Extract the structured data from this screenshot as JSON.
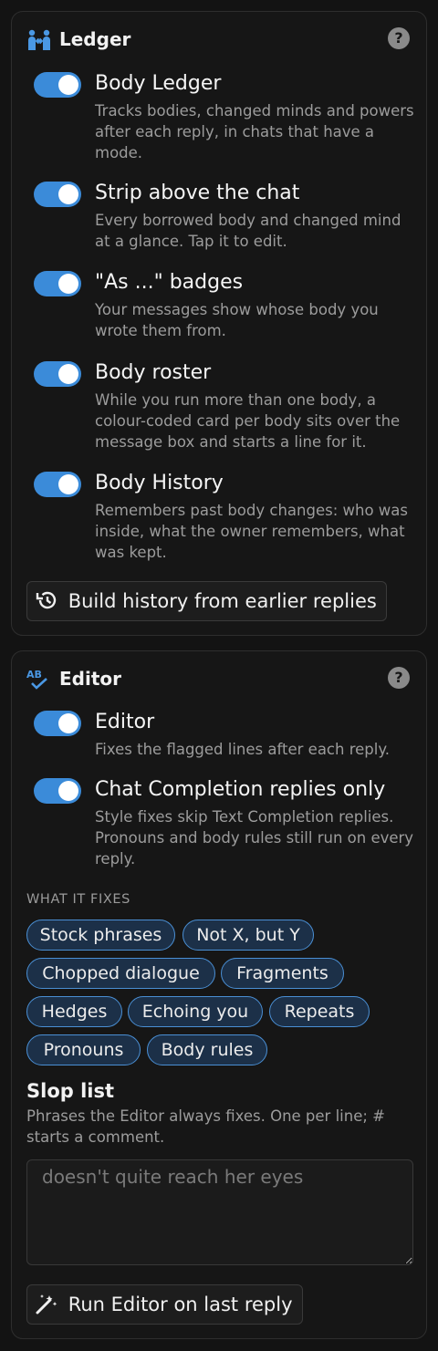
{
  "ledger": {
    "title": "Ledger",
    "help": "?",
    "options": [
      {
        "title": "Body Ledger",
        "desc": "Tracks bodies, changed minds and powers after each reply, in chats that have a mode.",
        "enabled": true
      },
      {
        "title": "Strip above the chat",
        "desc": "Every borrowed body and changed mind at a glance. Tap it to edit.",
        "enabled": true
      },
      {
        "title": "\"As ...\" badges",
        "desc": "Your messages show whose body you wrote them from.",
        "enabled": true
      },
      {
        "title": "Body roster",
        "desc": "While you run more than one body, a colour-coded card per body sits over the message box and starts a line for it.",
        "enabled": true
      },
      {
        "title": "Body History",
        "desc": "Remembers past body changes: who was inside, what the owner remembers, what was kept.",
        "enabled": true
      }
    ],
    "build_button": "Build history from earlier replies"
  },
  "editor": {
    "title": "Editor",
    "icon_text": "AB",
    "help": "?",
    "options": [
      {
        "title": "Editor",
        "desc": "Fixes the flagged lines after each reply.",
        "enabled": true
      },
      {
        "title": "Chat Completion replies only",
        "desc": "Style fixes skip Text Completion replies. Pronouns and body rules still run on every reply.",
        "enabled": true
      }
    ],
    "fixes_label": "WHAT IT FIXES",
    "fixes": [
      "Stock phrases",
      "Not X, but Y",
      "Chopped dialogue",
      "Fragments",
      "Hedges",
      "Echoing you",
      "Repeats",
      "Pronouns",
      "Body rules"
    ],
    "slop_title": "Slop list",
    "slop_desc": "Phrases the Editor always fixes. One per line; # starts a comment.",
    "slop_placeholder": "doesn't quite reach her eyes",
    "run_button": "Run Editor on last reply"
  },
  "colors": {
    "accent": "#3b8bd9",
    "chip_border": "#4a8fd4",
    "chip_bg": "#1c3048"
  }
}
